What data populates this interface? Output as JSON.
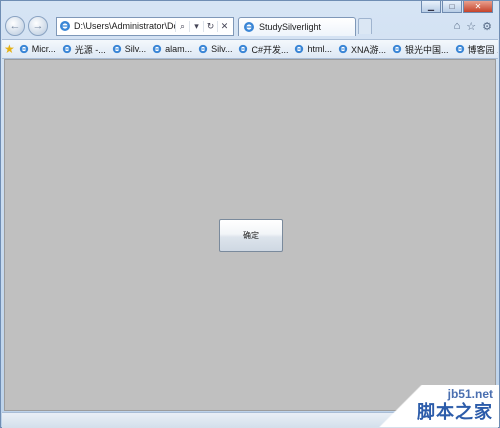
{
  "window_controls": {
    "minimize": "▁",
    "maximize": "□",
    "close": "✕"
  },
  "nav": {
    "back_glyph": "←",
    "forward_glyph": "→",
    "address_value": "D:\\Users\\Administrator\\Documents",
    "search_glyph": "⌕",
    "dropdown_glyph": "▾",
    "refresh_glyph": "↻",
    "stop_glyph": "✕",
    "right_tools": {
      "home": "⌂",
      "favorites": "☆",
      "tools": "⚙"
    }
  },
  "tab": {
    "title": "StudySilverlight"
  },
  "favorites": {
    "star": "★",
    "items": [
      {
        "label": "Micr..."
      },
      {
        "label": "光源 -..."
      },
      {
        "label": "Silv..."
      },
      {
        "label": "alam..."
      },
      {
        "label": "Silv..."
      },
      {
        "label": "C#开发..."
      },
      {
        "label": "html..."
      },
      {
        "label": "XNA游..."
      },
      {
        "label": "银光中国..."
      },
      {
        "label": "博客园 ..."
      }
    ],
    "more": "»"
  },
  "content": {
    "button_label": "确定"
  },
  "watermark": {
    "site": "jb51.net",
    "brand": "脚本之家"
  },
  "colors": {
    "content_bg": "#c0c0c0",
    "chrome": "#c8d8ea",
    "accent": "#2c5caa"
  }
}
